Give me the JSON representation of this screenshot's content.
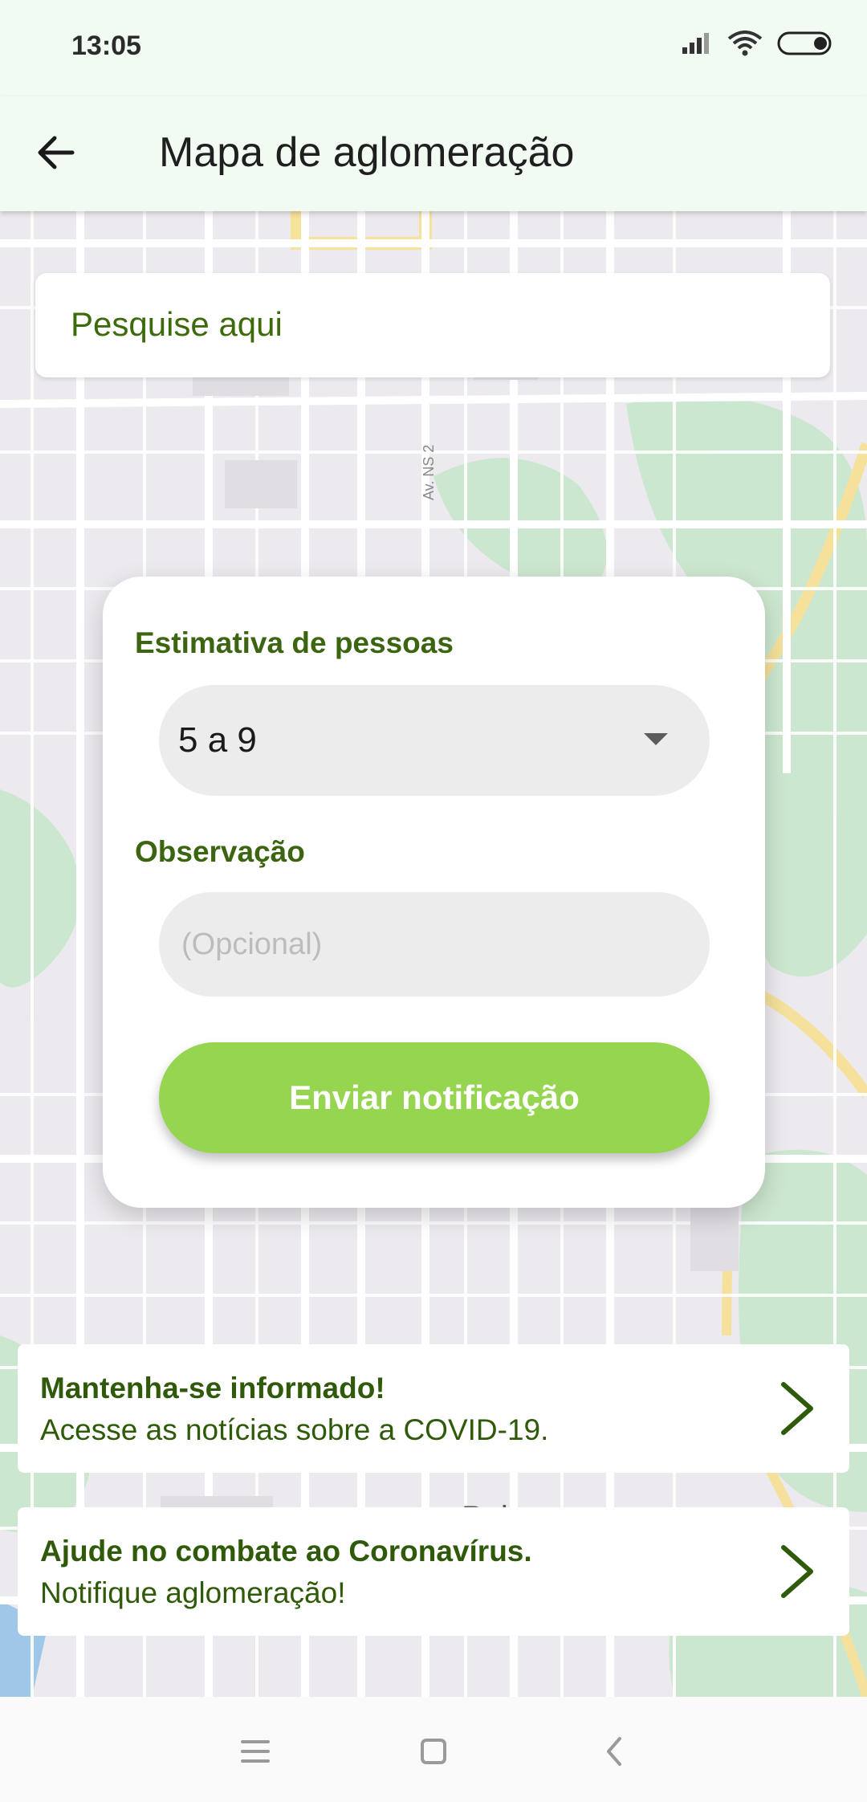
{
  "status_bar": {
    "time": "13:05"
  },
  "app_bar": {
    "title": "Mapa de aglomeração"
  },
  "search": {
    "placeholder": "Pesquise aqui"
  },
  "map": {
    "city_label": "Palmas",
    "road_label": "Av. NS 2"
  },
  "dialog": {
    "people_label": "Estimativa de pessoas",
    "people_value": "5 a 9",
    "observation_label": "Observação",
    "observation_placeholder": "(Opcional)",
    "observation_value": "",
    "send_label": "Enviar notificação"
  },
  "info_cards": [
    {
      "title": "Mantenha-se informado!",
      "subtitle": "Acesse as notícias sobre a COVID-19."
    },
    {
      "title": "Ajude no combate ao Coronavírus.",
      "subtitle": "Notifique aglomeração!"
    }
  ],
  "colors": {
    "accent_green": "#95d550",
    "label_green": "#3b6510",
    "header_bg": "#f1fbf2"
  },
  "icons": [
    "back-arrow-icon",
    "signal-icon",
    "wifi-icon",
    "battery-icon",
    "chevron-right-icon",
    "menu-icon",
    "home-icon",
    "back-icon"
  ]
}
